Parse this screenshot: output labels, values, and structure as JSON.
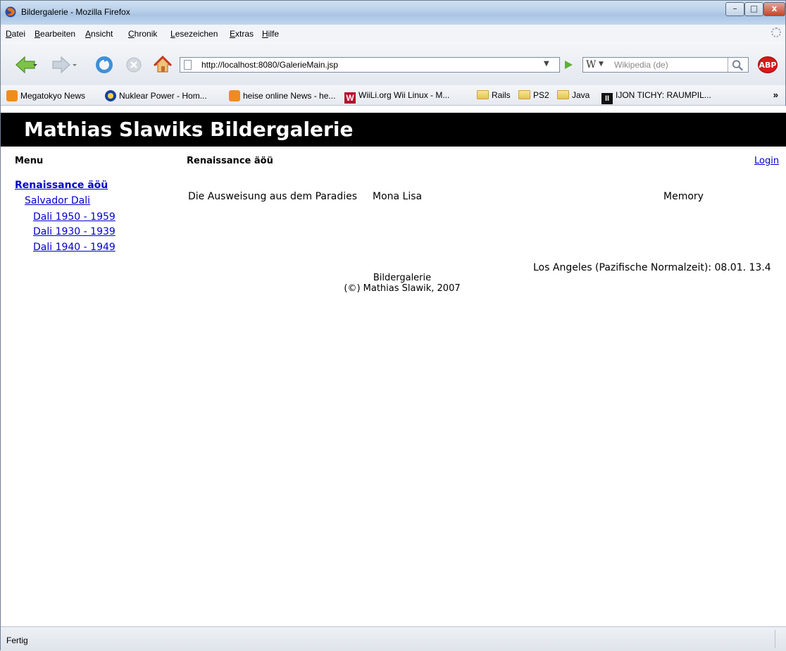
{
  "window": {
    "title": "Bildergalerie - Mozilla Firefox",
    "min_glyph": "–",
    "max_glyph": "□",
    "close_glyph": "x"
  },
  "menubar": {
    "items": [
      {
        "ul": "D",
        "rest": "atei"
      },
      {
        "ul": "B",
        "rest": "earbeiten"
      },
      {
        "ul": "A",
        "rest": "nsicht"
      },
      {
        "ul": "C",
        "rest": "hronik"
      },
      {
        "ul": "L",
        "rest": "esezeichen"
      },
      {
        "ul": "E",
        "rest": "xtras"
      },
      {
        "ul": "H",
        "rest": "ilfe"
      }
    ]
  },
  "navbar": {
    "url": "http://localhost:8080/GalerieMain.jsp",
    "search_engine": "W",
    "search_placeholder": "Wikipedia (de)",
    "adblock_label": "ABP"
  },
  "bookmarks": [
    {
      "icon": "rss",
      "label": "Megatokyo News"
    },
    {
      "icon": "nuk",
      "label": "Nuklear Power - Hom..."
    },
    {
      "icon": "rss",
      "label": "heise online News - he..."
    },
    {
      "icon": "wii",
      "label": "WiiLi.org Wii Linux - M..."
    },
    {
      "icon": "folder",
      "label": "Rails"
    },
    {
      "icon": "folder",
      "label": "PS2"
    },
    {
      "icon": "folder",
      "label": "Java"
    },
    {
      "icon": "ijon",
      "label": "IJON TICHY: RAUMPIL..."
    }
  ],
  "bookmarks_more": "»",
  "page": {
    "site_title": "Mathias Slawiks Bildergalerie",
    "menu_heading": "Menu",
    "section_heading": "Renaissance äöü",
    "login": "Login",
    "nav": {
      "top": "Renaissance äöü",
      "artist": "Salvador Dali",
      "periods": [
        "Dali 1950 - 1959",
        "Dali 1930 - 1939",
        "Dali 1940 - 1949"
      ]
    },
    "gallery": [
      "Die Ausweisung aus dem Paradies",
      "Mona Lisa",
      "Memory"
    ],
    "clock": "Los Angeles (Pazifische Normalzeit): 08.01. 13.4",
    "footer_line1": "Bildergalerie",
    "footer_line2": "(©) Mathias Slawik, 2007"
  },
  "status": "Fertig"
}
